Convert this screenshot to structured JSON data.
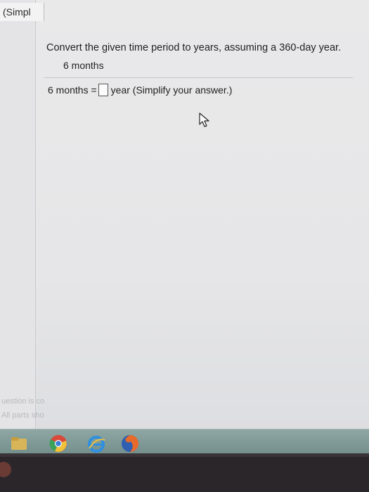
{
  "sidebar": {
    "top_label": "(Simpl",
    "faded_line_1": "uestion is co",
    "faded_line_2": "All parts sho"
  },
  "question": {
    "prompt": "Convert the given time period to years, assuming a 360-day year.",
    "given_value": "6 months",
    "answer_prefix": "6 months =",
    "answer_value": "",
    "answer_suffix": "year (Simplify your answer.)"
  },
  "taskbar": {
    "icons": [
      "file-explorer-icon",
      "chrome-icon",
      "internet-explorer-icon",
      "firefox-icon"
    ]
  }
}
